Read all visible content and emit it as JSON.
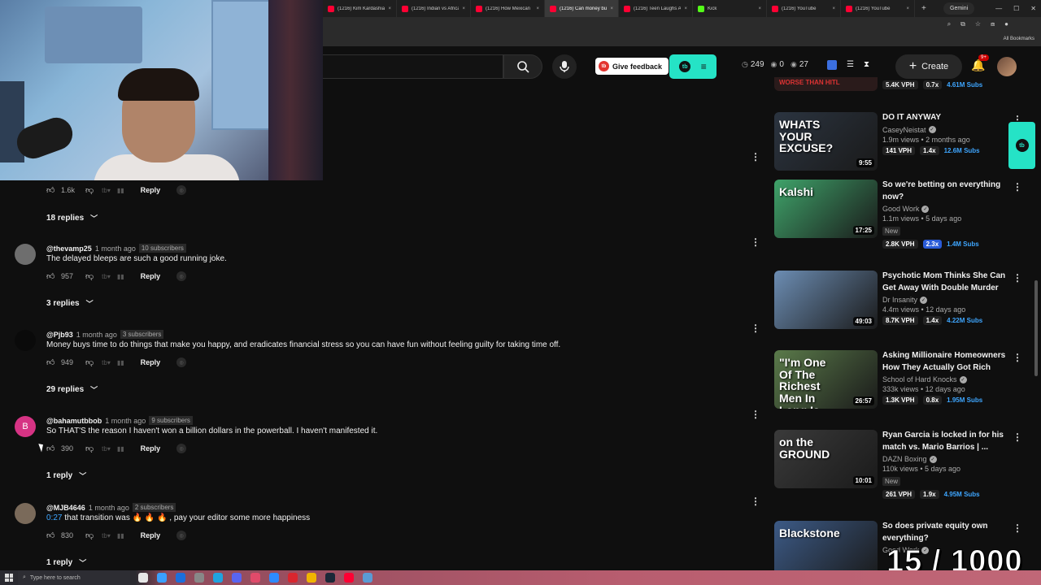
{
  "tabs": [
    {
      "label": "(1216) Kim Kardashian",
      "type": "yt"
    },
    {
      "label": "(1216) Indian vs Africa",
      "type": "yt"
    },
    {
      "label": "(1216) How Mexican",
      "type": "yt"
    },
    {
      "label": "(1216) Can money bu",
      "type": "yt",
      "active": true
    },
    {
      "label": "(1216) Teen Laughs A",
      "type": "yt"
    },
    {
      "label": "Kick",
      "type": "kick"
    },
    {
      "label": "(1216) YouTube",
      "type": "yt"
    },
    {
      "label": "(1216) YouTube",
      "type": "yt"
    }
  ],
  "browser": {
    "gemini_label": "Gemini",
    "all_bookmarks": "All Bookmarks"
  },
  "header": {
    "feedback_label": "Give feedback",
    "tb_logo": "tb",
    "stat_1": "249",
    "stat_2": "0",
    "stat_3": "27",
    "create_label": "Create",
    "notif_count": "9+"
  },
  "top_actions": {
    "likes": "1.6k",
    "reply": "Reply"
  },
  "top_replies": "18 replies",
  "comments": [
    {
      "handle": "@thevamp25",
      "time": "1 month ago",
      "subs": "10 subscribers",
      "text": "The delayed bleeps are such a good running joke.",
      "likes": "957",
      "reply": "Reply",
      "replies": "3 replies",
      "avatar_color": "#6e6e6e"
    },
    {
      "handle": "@Pjb93",
      "time": "1 month ago",
      "subs": "3 subscribers",
      "text": "Money buys time to do things that make you happy, and eradicates financial stress so you can have fun without feeling guilty for taking time off.",
      "likes": "949",
      "reply": "Reply",
      "replies": "29 replies",
      "avatar_color": "#0a0a0a"
    },
    {
      "handle": "@bahamutbbob",
      "time": "1 month ago",
      "subs": "9 subscribers",
      "text": "So THAT'S the reason I haven't won a billion dollars in the powerball. I haven't manifested it.",
      "likes": "390",
      "reply": "Reply",
      "replies": "1 reply",
      "avatar_color": "#d63384",
      "avatar_letter": "B"
    },
    {
      "handle": "@MJB4646",
      "time": "1 month ago",
      "subs": "2 subscribers",
      "timestamp": "0:27",
      "text": " that transition was 🔥 🔥 🔥 , pay your editor some more happiness",
      "likes": "830",
      "reply": "Reply",
      "replies": "1 reply",
      "avatar_color": "#7a6a5a"
    }
  ],
  "top_partial": {
    "thumb_text": "WORSE THAN HITL",
    "vph": "5.4K VPH",
    "mult": "0.7x",
    "subs": "4.61M Subs"
  },
  "videos": [
    {
      "title": "DO IT ANYWAY",
      "channel": "CaseyNeistat",
      "meta": "1.9m views • 2 months ago",
      "duration": "9:55",
      "thumb_text": "WHATS YOUR EXCUSE?",
      "vph": "141 VPH",
      "mult": "1.4x",
      "subs": "12.6M Subs",
      "thumb_color": "#2b3440",
      "new": ""
    },
    {
      "title": "So we're betting on everything now?",
      "channel": "Good Work",
      "meta": "1.1m views • 5 days ago",
      "duration": "17:25",
      "thumb_text": "Kalshi",
      "vph": "2.8K VPH",
      "mult": "2.3x",
      "mult_blue": true,
      "subs": "1.4M Subs",
      "thumb_color": "#3fa36a",
      "new": "New"
    },
    {
      "title": "Psychotic Mom Thinks She Can Get Away With Double Murder",
      "channel": "Dr Insanity",
      "meta": "4.4m views • 12 days ago",
      "duration": "49:03",
      "thumb_text": "",
      "vph": "8.7K VPH",
      "mult": "1.4x",
      "subs": "4.22M Subs",
      "thumb_color": "#6c8db3",
      "new": ""
    },
    {
      "title": "Asking Millionaire Homeowners How They Actually Got Rich",
      "channel": "School of Hard Knocks",
      "meta": "333k views • 12 days ago",
      "duration": "26:57",
      "thumb_text": "\"I'm One Of The Richest Men In Long Is",
      "vph": "1.3K VPH",
      "mult": "0.8x",
      "subs": "1.95M Subs",
      "thumb_color": "#5a7a4a",
      "new": ""
    },
    {
      "title": "Ryan Garcia is locked in for his match vs. Mario Barrios | ...",
      "channel": "DAZN Boxing",
      "meta": "110k views • 5 days ago",
      "duration": "10:01",
      "thumb_text": "on the GROUND",
      "vph": "261 VPH",
      "mult": "1.9x",
      "subs": "4.95M Subs",
      "thumb_color": "#3a3a3a",
      "new": "New"
    },
    {
      "title": "So does private equity own everything?",
      "channel": "Good Work",
      "meta": "",
      "duration": "",
      "thumb_text": "Blackstone",
      "vph": "",
      "mult": "",
      "subs": "",
      "thumb_color": "#3c5a86",
      "new": ""
    }
  ],
  "overlay_counter": "15 / 1000",
  "taskbar": {
    "search_placeholder": "Type here to search"
  },
  "colors": {
    "accent_teal": "#25e3c6",
    "link_blue": "#3ea6ff",
    "yt_red": "#ff0033"
  }
}
